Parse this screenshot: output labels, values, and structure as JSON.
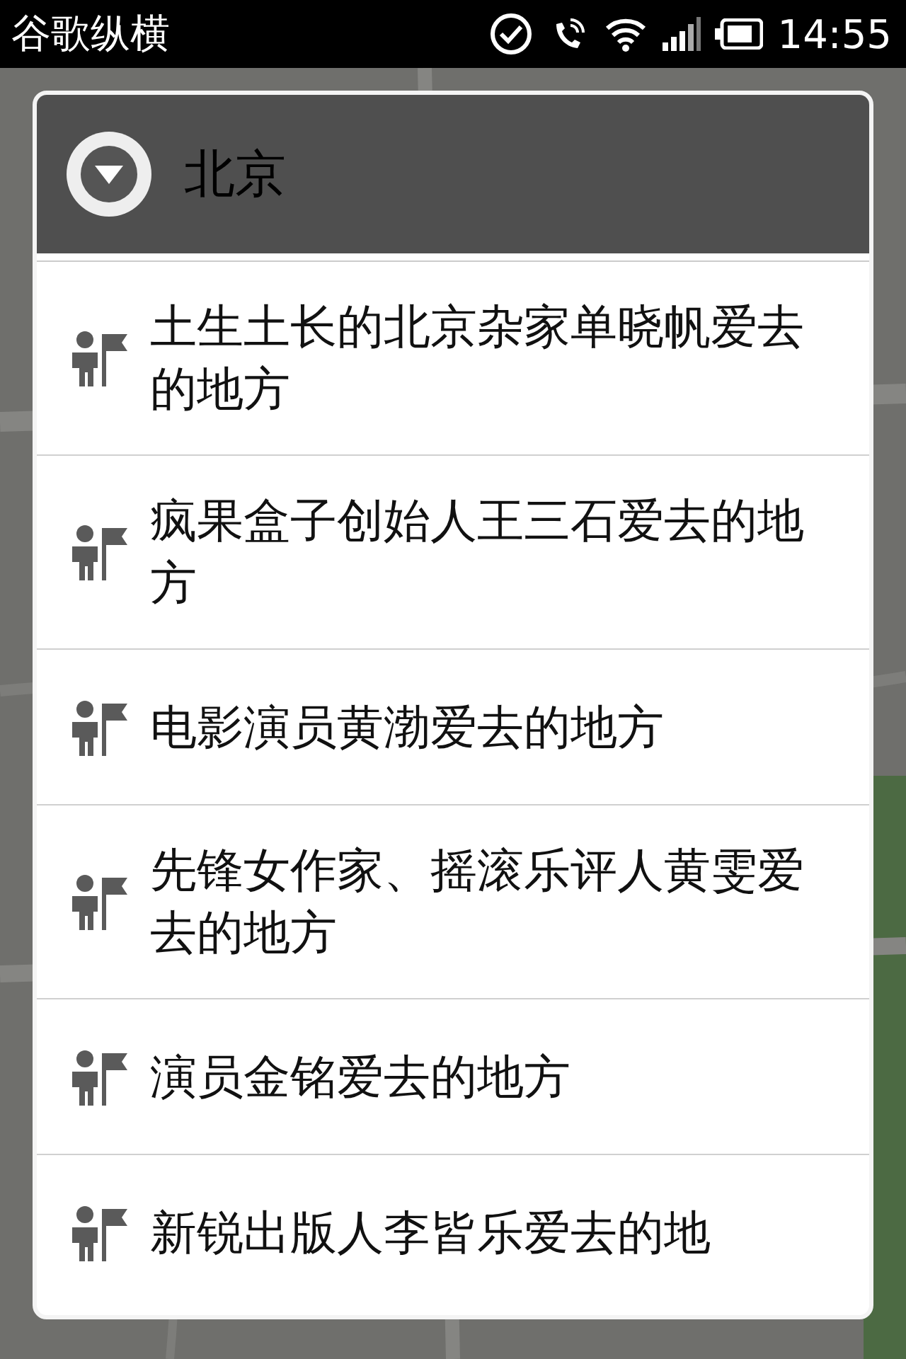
{
  "status_bar": {
    "app_name": "谷歌纵横",
    "time": "14:55"
  },
  "dialog": {
    "title": "北京",
    "items": [
      {
        "label": "土生土长的北京杂家单晓帆爱去的地方"
      },
      {
        "label": "疯果盒子创始人王三石爱去的地方"
      },
      {
        "label": "电影演员黄渤爱去的地方"
      },
      {
        "label": "先锋女作家、摇滚乐评人黄雯爱去的地方"
      },
      {
        "label": "演员金铭爱去的地方"
      },
      {
        "label": "新锐出版人李皆乐爱去的地"
      }
    ]
  }
}
